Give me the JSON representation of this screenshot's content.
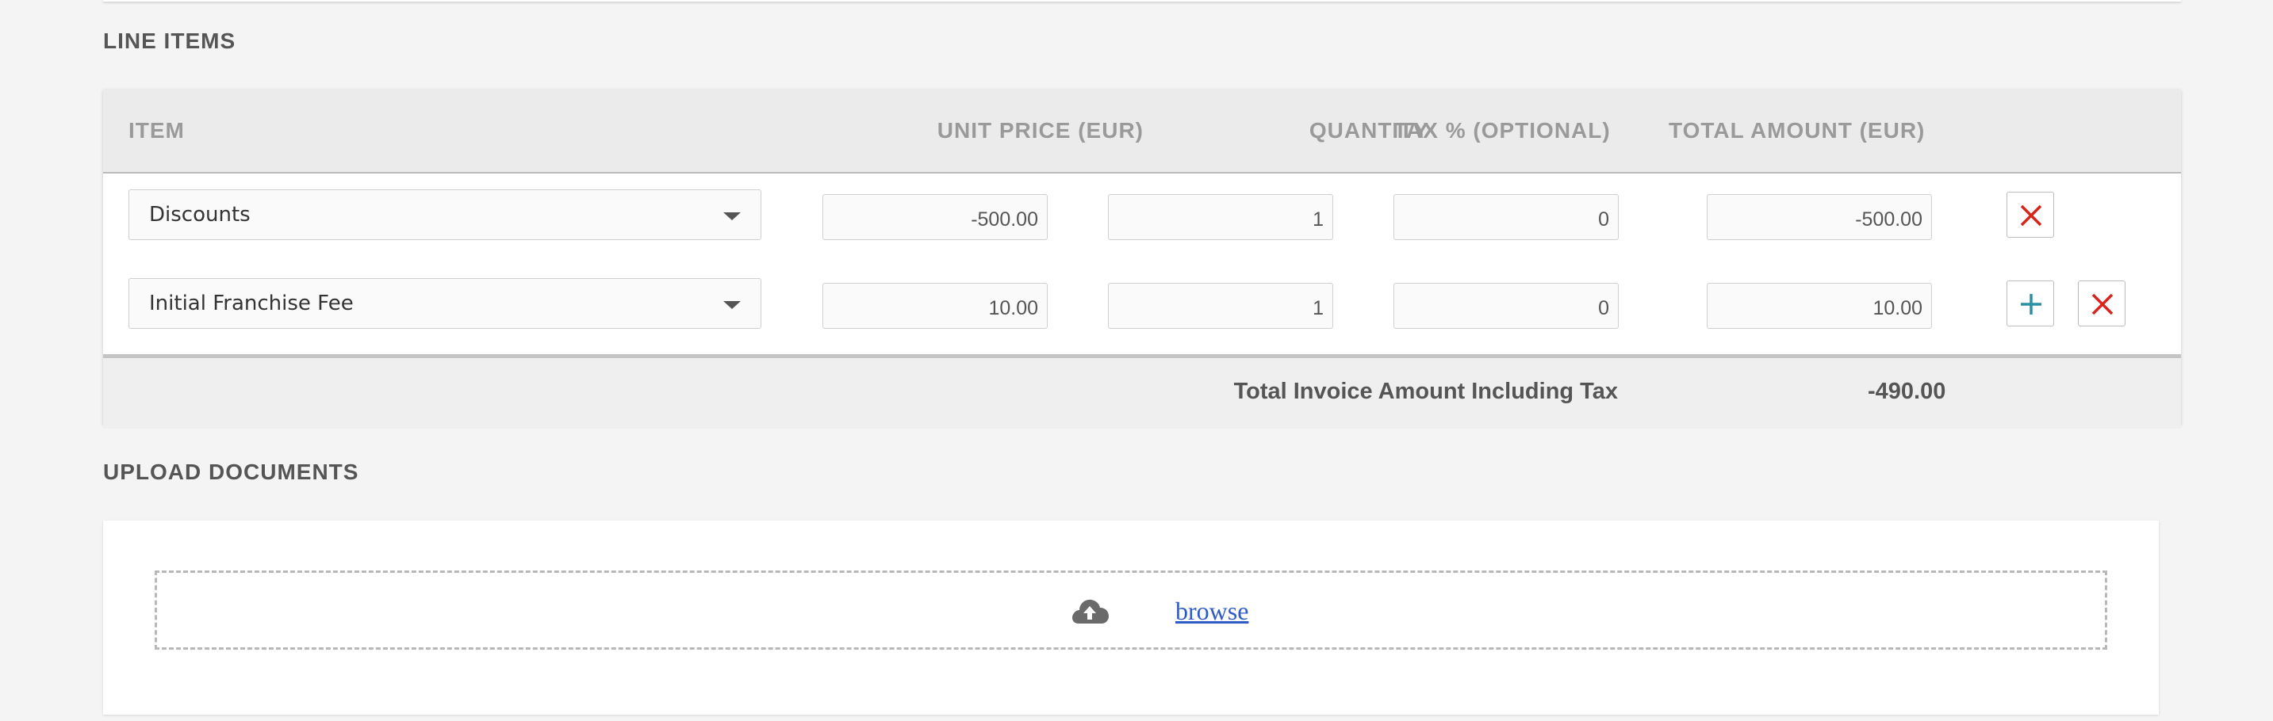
{
  "line_items": {
    "section_title": "LINE ITEMS",
    "columns": {
      "item": "ITEM",
      "unit_price": "UNIT PRICE (EUR)",
      "quantity": "QUANTITY",
      "tax": "TAX % (OPTIONAL)",
      "total": "TOTAL AMOUNT (EUR)"
    },
    "rows": [
      {
        "item": "Discounts",
        "unit_price": "-500.00",
        "quantity": "1",
        "tax": "0",
        "total": "-500.00"
      },
      {
        "item": "Initial Franchise Fee",
        "unit_price": "10.00",
        "quantity": "1",
        "tax": "0",
        "total": "10.00"
      }
    ],
    "footer": {
      "label": "Total Invoice Amount Including Tax",
      "total": "-490.00"
    }
  },
  "upload": {
    "section_title": "UPLOAD DOCUMENTS",
    "browse_label": "browse"
  },
  "icons": {
    "dropdown": "chevron-down-icon",
    "remove": "close-icon",
    "add": "plus-icon",
    "upload": "cloud-upload-icon"
  },
  "colors": {
    "remove_icon": "#d9241c",
    "add_icon": "#2c8fa8",
    "link": "#2f5bc9"
  }
}
